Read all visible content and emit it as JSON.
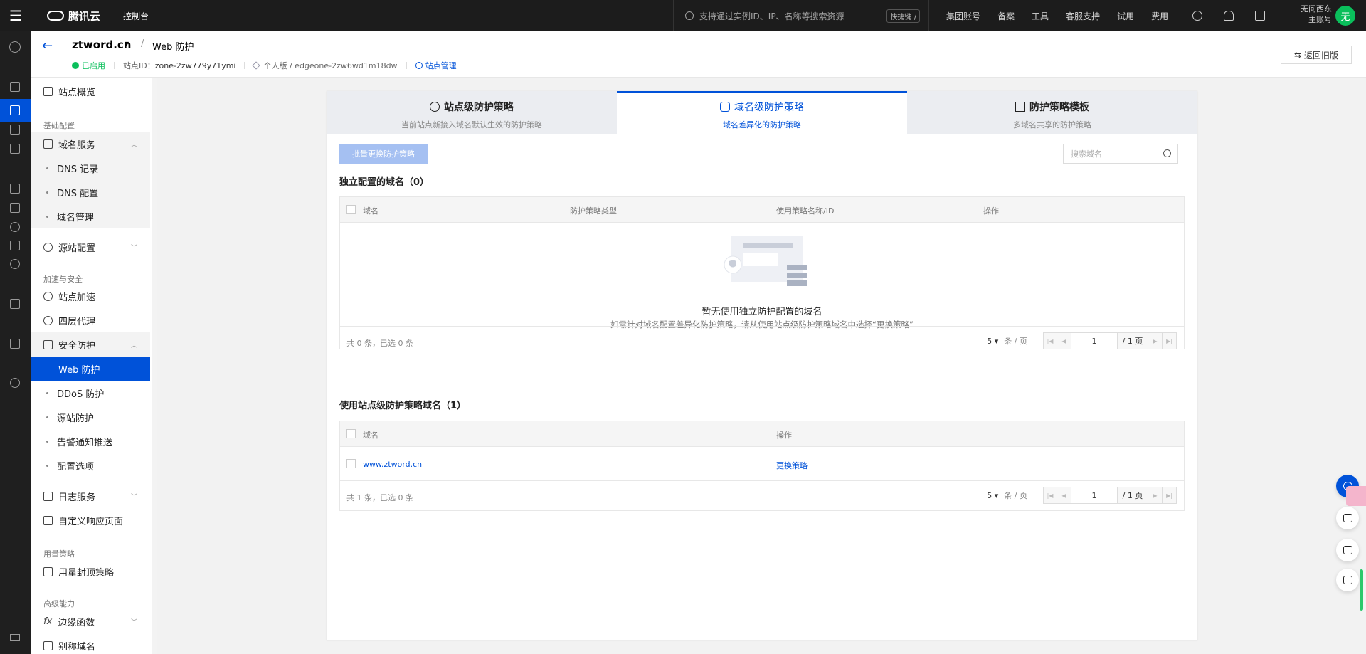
{
  "topbar": {
    "brand": "腾讯云",
    "console": "控制台",
    "search_placeholder": "支持通过实例ID、IP、名称等搜索资源",
    "shortcut": "快捷键 /",
    "nav": [
      "集团账号",
      "备案",
      "工具",
      "客服支持",
      "试用",
      "费用"
    ],
    "user_line1": "无问西东",
    "user_line2": "主账号",
    "avatar": "无"
  },
  "header": {
    "site_name": "ztword.cn",
    "page_title": "Web 防护",
    "status": "已启用",
    "site_id_label": "站点ID：",
    "site_id": "zone-2zw779y71ymi",
    "plan": "个人版 / edgeone-2zw6wd1m18dw",
    "manage_link": "站点管理",
    "old_version_btn": "返回旧版"
  },
  "sidebar": {
    "overview": "站点概览",
    "group_basic": "基础配置",
    "domain_service": "域名服务",
    "dns_records": "DNS 记录",
    "dns_config": "DNS 配置",
    "domain_manage": "域名管理",
    "origin_config": "源站配置",
    "group_accel": "加速与安全",
    "site_accel": "站点加速",
    "l4_proxy": "四层代理",
    "security": "安全防护",
    "web_protect": "Web 防护",
    "ddos": "DDoS 防护",
    "origin_protect": "源站防护",
    "alert": "告警通知推送",
    "config_options": "配置选项",
    "log_service": "日志服务",
    "custom_page": "自定义响应页面",
    "group_usage": "用量策略",
    "usage_cap": "用量封顶策略",
    "group_advanced": "高级能力",
    "edge_function": "边缘函数",
    "alias_domain": "别称域名"
  },
  "tabs": [
    {
      "title": "站点级防护策略",
      "subtitle": "当前站点新接入域名默认生效的防护策略"
    },
    {
      "title": "域名级防护策略",
      "subtitle": "域名差异化的防护策略"
    },
    {
      "title": "防护策略模板",
      "subtitle": "多域名共享的防护策略"
    }
  ],
  "toolbar": {
    "batch_btn": "批量更换防护策略",
    "search_placeholder": "搜索域名"
  },
  "table1": {
    "title": "独立配置的域名（0）",
    "columns": [
      "域名",
      "防护策略类型",
      "使用策略名称/ID",
      "操作"
    ],
    "empty_title": "暂无使用独立防护配置的域名",
    "empty_desc": "如需针对域名配置差异化防护策略，请从使用站点级防护策略域名中选择“更换策略”",
    "total": "共 0 条，已选 0 条",
    "page_size": "5",
    "per_page": "条 / 页",
    "page": "1",
    "page_total": "/ 1 页"
  },
  "table2": {
    "title": "使用站点级防护策略域名（1）",
    "columns": [
      "域名",
      "操作"
    ],
    "rows": [
      {
        "domain": "www.ztword.cn",
        "action": "更换策略"
      }
    ],
    "total": "共 1 条，已选 0 条",
    "page_size": "5",
    "per_page": "条 / 页",
    "page": "1",
    "page_total": "/ 1 页"
  },
  "colors": {
    "accent": "#0052d9",
    "success": "#0abf5b",
    "topbar": "#1c1c1c"
  }
}
